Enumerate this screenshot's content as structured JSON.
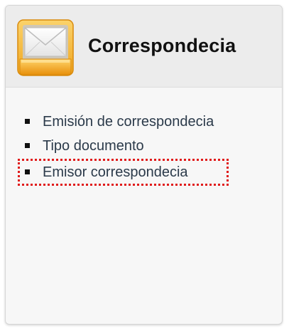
{
  "panel": {
    "title": "Correspondecia",
    "icon": "mail-tray-icon",
    "items": [
      {
        "label": "Emisión de correspondecia"
      },
      {
        "label": "Tipo documento"
      },
      {
        "label": "Emisor correspondecia",
        "focused": true
      }
    ]
  },
  "colors": {
    "link": "#2b3a4a",
    "focus_outline": "#e01b1b",
    "icon_tray": "#f2a21a"
  }
}
